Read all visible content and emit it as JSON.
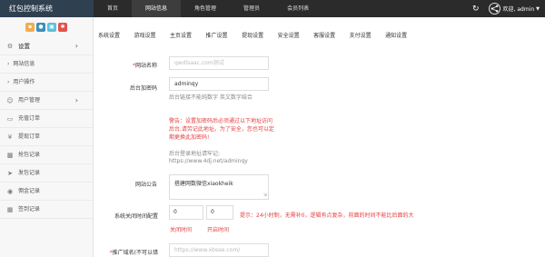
{
  "app": {
    "title": "红包控制系统"
  },
  "topnav": {
    "items": [
      {
        "label": "首页"
      },
      {
        "label": "网站信息"
      },
      {
        "label": "角色管理"
      },
      {
        "label": "管理员"
      },
      {
        "label": "会员列表"
      }
    ],
    "active_index": 1,
    "user_label": "欢迎, admin"
  },
  "sidebar": {
    "quick_buttons": [
      {
        "icon": "chart-icon",
        "color": "#f0ad4e"
      },
      {
        "icon": "user-icon",
        "color": "#3c8dbc"
      },
      {
        "icon": "message-icon",
        "color": "#5bc0de"
      },
      {
        "icon": "gear-icon",
        "color": "#e2534b"
      }
    ],
    "settings_label": "设置",
    "sub_items": [
      {
        "label": "网站信息"
      },
      {
        "label": "用户操作"
      }
    ],
    "items": [
      {
        "label": "用户管理",
        "icon": "users-icon"
      },
      {
        "label": "充值订单",
        "icon": "card-icon"
      },
      {
        "label": "提现订单",
        "icon": "yen-icon"
      },
      {
        "label": "抢包记录",
        "icon": "bar-chart-icon"
      },
      {
        "label": "发包记录",
        "icon": "send-icon"
      },
      {
        "label": "佣金记录",
        "icon": "coin-icon"
      },
      {
        "label": "签到记录",
        "icon": "calendar-icon"
      }
    ]
  },
  "tabs": [
    "系统设置",
    "游戏设置",
    "主页设置",
    "推广设置",
    "提现设置",
    "安全设置",
    "客服设置",
    "支付设置",
    "通知设置"
  ],
  "form": {
    "site_name": {
      "label": "网站名称",
      "value": "qwdlsaac.com测试"
    },
    "backend_password": {
      "label": "后台加密码",
      "value": "adminqy",
      "hint": "后台链接不能纯数字 英文数字结合",
      "warning": "警告：设置加密码后必须通过以下地址访问后台,请劳记此地址。为了安全，您也可以定期更换此加密码!",
      "url_hint": "后台登录地址请牢记:",
      "url": "https://www.4dj.net/adminqy"
    },
    "notice": {
      "label": "网站公告",
      "value": "搭建网数微信xiaokheik"
    },
    "close_time": {
      "label": "系统关闭时间配置",
      "start": "0",
      "end": "0",
      "tip": "提示：24小时制，无需补0，逻辑有点复杂，前面的时间不能比后面的大",
      "start_label": "关闭时间",
      "end_label": "开启时间"
    },
    "promo_domain": {
      "label": "推广域名(不可以错",
      "value": "https://www.xbsee.com/"
    }
  }
}
